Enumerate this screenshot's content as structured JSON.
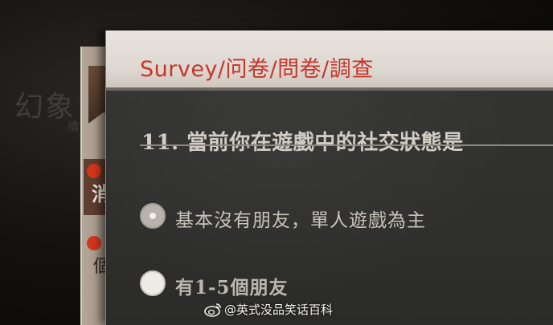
{
  "background": {
    "game_text": "幻象",
    "small_text": "贖"
  },
  "back_card": {
    "label": "消",
    "label_2": "個"
  },
  "header": {
    "title": "Survey/问卷/問卷/調查"
  },
  "question": {
    "text": "11. 當前你在遊戲中的社交狀態是"
  },
  "options": [
    {
      "label": "基本沒有朋友，單人遊戲為主",
      "selected": true
    },
    {
      "label": "有1-5個朋友",
      "selected": false
    }
  ],
  "watermark": {
    "text": "@英式没品笑话百科",
    "icon": "weibo-icon"
  },
  "colors": {
    "title_red": "#c6352c",
    "panel_dark": "#2f2f2d",
    "header_light": "#e9e4df",
    "accent_red_dot": "#d4351c"
  }
}
